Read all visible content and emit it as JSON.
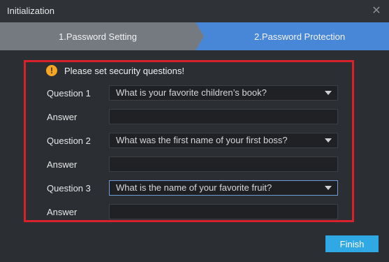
{
  "window": {
    "title": "Initialization",
    "close_icon": "close-icon"
  },
  "steps": [
    {
      "label": "1.Password Setting",
      "state": "completed"
    },
    {
      "label": "2.Password Protection",
      "state": "current"
    }
  ],
  "notice": {
    "icon": "warning-icon",
    "text": "Please set security questions!"
  },
  "questions": [
    {
      "label": "Question 1",
      "selected": "What is your favorite children’s book?",
      "answer_label": "Answer",
      "answer_value": ""
    },
    {
      "label": "Question 2",
      "selected": "What was the first name of your first boss?",
      "answer_label": "Answer",
      "answer_value": ""
    },
    {
      "label": "Question 3",
      "selected": "What is the name of your favorite fruit?",
      "answer_label": "Answer",
      "answer_value": ""
    }
  ],
  "finish_label": "Finish",
  "colors": {
    "accent": "#4887d8",
    "highlight_border": "#d9212b",
    "button": "#2fa8e6",
    "warning": "#f5a623"
  }
}
